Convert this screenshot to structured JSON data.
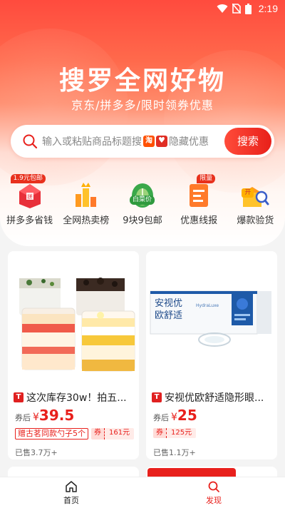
{
  "status_bar": {
    "time": "2:19",
    "icons": [
      "wifi-icon",
      "no-sim-icon",
      "battery-icon"
    ]
  },
  "hero": {
    "title": "搜罗全网好物",
    "subtitle": "京东/拼多多/限时领券优惠"
  },
  "search": {
    "placeholder_before": "输入或粘贴商品标题搜",
    "placeholder_after": "隐藏优惠",
    "taobao_badge": "淘",
    "button": "搜索"
  },
  "categories": [
    {
      "label": "拼多多省钱",
      "badge": "1.9元包邮",
      "icon": "pinduoduo-gift-icon"
    },
    {
      "label": "全网热卖榜",
      "icon": "bar-chart-crown-icon"
    },
    {
      "label": "9块9包邮",
      "badge": "白菜价",
      "icon": "cabbage-icon"
    },
    {
      "label": "优惠线报",
      "badge": "限量",
      "icon": "coupon-document-icon"
    },
    {
      "label": "爆款验货",
      "badge": "开",
      "icon": "magnifier-box-icon"
    }
  ],
  "products": [
    {
      "name": "这次库存30w！拍五...",
      "badge": "T",
      "price_prefix": "券后",
      "currency": "¥",
      "price": "39.5",
      "gift": "赠古茗同款勺子5个",
      "coupon_label": "券",
      "coupon_value": "161元",
      "sold": "已售3.7万+"
    },
    {
      "name": "安视优欧舒适隐形眼...",
      "badge": "T",
      "price_prefix": "券后",
      "currency": "¥",
      "price": "25",
      "coupon_label": "券",
      "coupon_value": "125元",
      "sold": "已售1.1万+",
      "product_box_text": {
        "brand": "安视优",
        "line": "欧舒适",
        "sub": "HydraLuxe"
      }
    }
  ],
  "bottom_nav": [
    {
      "label": "首页",
      "icon": "home-icon",
      "active": false
    },
    {
      "label": "发现",
      "icon": "search-icon",
      "active": true
    }
  ],
  "colors": {
    "accent": "#e8201c",
    "hero_top": "#ff4b3e"
  }
}
